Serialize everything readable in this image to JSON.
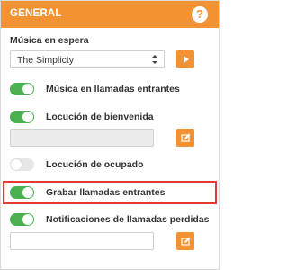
{
  "header": {
    "title": "GENERAL",
    "help_icon": "question-icon"
  },
  "hold_music": {
    "label": "Música en espera",
    "selected": "The Simplicty",
    "play_icon": "play-icon"
  },
  "toggles": [
    {
      "label": "Música en llamadas entrantes",
      "on": true
    },
    {
      "label": "Locución de bienvenida",
      "on": true,
      "input_value": "",
      "input_disabled": true,
      "edit_icon": "edit-icon"
    },
    {
      "label": "Locución de ocupado",
      "on": false
    },
    {
      "label": "Grabar llamadas entrantes",
      "on": true,
      "highlighted": true
    },
    {
      "label": "Notificaciones de llamadas perdidas",
      "on": true,
      "input_value": "",
      "input_disabled": false,
      "edit_icon": "edit-icon"
    }
  ],
  "colors": {
    "accent": "#f39232",
    "toggle_on": "#4caf50",
    "highlight": "#e53935"
  }
}
